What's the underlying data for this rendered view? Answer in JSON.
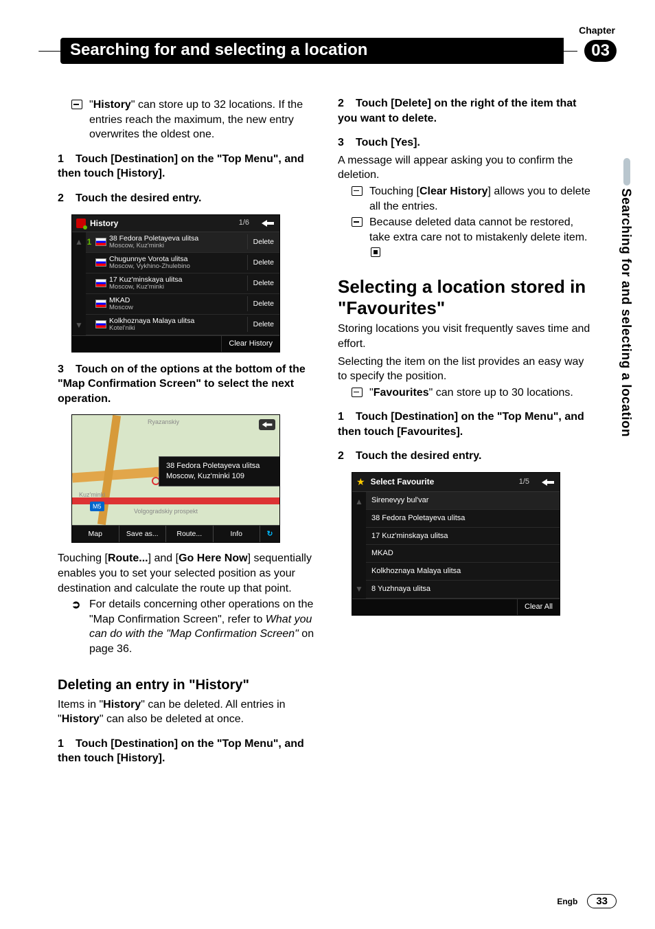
{
  "header": {
    "chapter_label": "Chapter",
    "chapter_number": "03",
    "title": "Searching for and selecting a location"
  },
  "side_tab": "Searching for and selecting a location",
  "left": {
    "note1_a": "\"",
    "note1_b": "History",
    "note1_c": "\" can store up to 32 locations. If the entries reach the maximum, the new entry overwrites the oldest one.",
    "step1_num": "1",
    "step1": "Touch [Destination] on the \"Top Menu\", and then touch [History].",
    "step2_num": "2",
    "step2": "Touch the desired entry.",
    "history": {
      "title": "History",
      "pager": "1/6",
      "rows": [
        {
          "rank": "1",
          "l1": "38 Fedora Poletayeva ulitsa",
          "l2": "Moscow, Kuz'minki",
          "del": "Delete"
        },
        {
          "rank": "",
          "l1": "Chugunnye Vorota ulitsa",
          "l2": "Moscow, Vykhino-Zhulebino",
          "del": "Delete"
        },
        {
          "rank": "",
          "l1": "17 Kuz'minskaya ulitsa",
          "l2": "Moscow, Kuz'minki",
          "del": "Delete"
        },
        {
          "rank": "",
          "l1": "MKAD",
          "l2": "Moscow",
          "del": "Delete"
        },
        {
          "rank": "",
          "l1": "Kolkhoznaya Malaya ulitsa",
          "l2": "Kotel'niki",
          "del": "Delete"
        }
      ],
      "footer_btn": "Clear History"
    },
    "step3_num": "3",
    "step3": "Touch on of the options at the bottom of the \"Map Confirmation Screen\" to select the next operation.",
    "map": {
      "addr_l1": "38 Fedora Poletayeva ulitsa",
      "addr_l2": "Moscow, Kuz'minki 109",
      "roadnum": "M5",
      "d1": "Ryazanskiy",
      "d2": "Kuz'minki",
      "d3": "Volgogradskiy prospekt",
      "toolbar": [
        "Map",
        "Save as...",
        "Route...",
        "Info"
      ]
    },
    "after_map_a": "Touching [",
    "after_map_b": "Route...",
    "after_map_c": "] and [",
    "after_map_d": "Go Here Now",
    "after_map_e": "] sequentially enables you to set your selected position as your destination and calculate the route up that point.",
    "xref_a": "For details concerning other operations on the \"Map Confirmation Screen\", refer to ",
    "xref_b": "What you can do with the \"Map Confirmation Screen\"",
    "xref_c": " on page 36.",
    "h3": "Deleting an entry in \"History\"",
    "del_p_a": "Items in \"",
    "del_p_b": "History",
    "del_p_c": "\" can be deleted. All entries in \"",
    "del_p_d": "History",
    "del_p_e": "\" can also be deleted at once.",
    "del_step1_num": "1",
    "del_step1": "Touch [Destination] on the \"Top Menu\", and then touch [History]."
  },
  "right": {
    "step2_num": "2",
    "step2": "Touch [Delete] on the right of the item that you want to delete.",
    "step3_num": "3",
    "step3_head": "Touch [Yes].",
    "step3_body": "A message will appear asking you to confirm the deletion.",
    "note1_a": "Touching [",
    "note1_b": "Clear History",
    "note1_c": "] allows you to delete all the entries.",
    "note2": "Because deleted data cannot be restored, take extra care not to mistakenly delete item.",
    "h2_a": "Selecting a location stored in \"",
    "h2_b": "Favourites",
    "h2_c": "\"",
    "p1": "Storing locations you visit frequently saves time and effort.",
    "p2": "Selecting the item on the list provides an easy way to specify the position.",
    "note3_a": "\"",
    "note3_b": "Favourites",
    "note3_c": "\" can store up to 30 locations.",
    "fav_step1_num": "1",
    "fav_step1": "Touch [Destination] on the \"Top Menu\", and then touch [Favourites].",
    "fav_step2_num": "2",
    "fav_step2": "Touch the desired entry.",
    "fav": {
      "title": "Select Favourite",
      "pager": "1/5",
      "rows": [
        "Sirenevyy bul'var",
        "38 Fedora Poletayeva ulitsa",
        "17 Kuz'minskaya ulitsa",
        "MKAD",
        "Kolkhoznaya Malaya ulitsa",
        "8 Yuzhnaya ulitsa"
      ],
      "footer_btn": "Clear All"
    }
  },
  "footer": {
    "lang": "Engb",
    "page": "33"
  }
}
